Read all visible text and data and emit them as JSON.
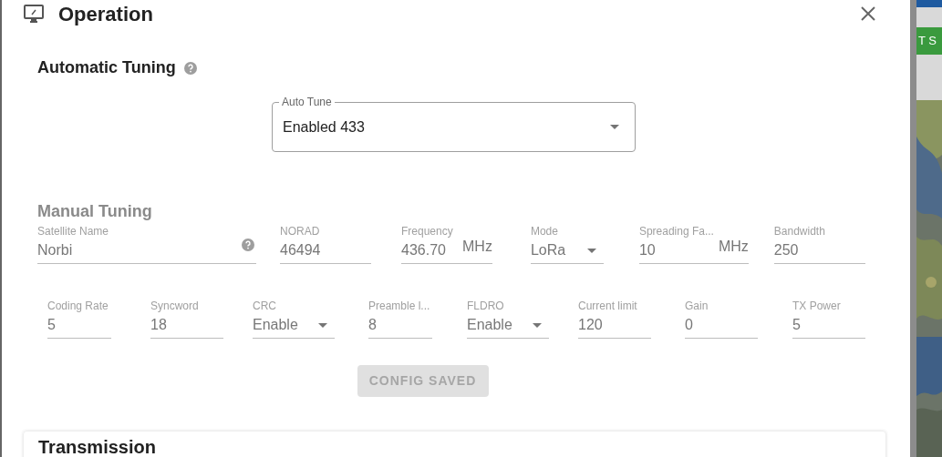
{
  "dialog": {
    "title": "Operation"
  },
  "automatic_tuning": {
    "heading": "Automatic Tuning",
    "auto_tune": {
      "label": "Auto Tune",
      "value": "Enabled 433"
    }
  },
  "manual_tuning": {
    "heading": "Manual Tuning",
    "disabled": true,
    "rows": [
      {
        "fields": [
          {
            "kind": "text",
            "label": "Satellite Name",
            "value": "Norbi",
            "help": true
          },
          {
            "kind": "text",
            "label": "NORAD",
            "value": "46494"
          },
          {
            "kind": "text",
            "label": "Frequency",
            "value": "436.70",
            "suffix": "MHz"
          },
          {
            "kind": "select",
            "label": "Mode",
            "value": "LoRa"
          },
          {
            "kind": "text",
            "label": "Spreading Fa...",
            "value": "10",
            "suffix": "MHz"
          },
          {
            "kind": "text",
            "label": "Bandwidth",
            "value": "250"
          }
        ]
      },
      {
        "fields": [
          {
            "kind": "text",
            "label": "Coding Rate",
            "value": "5"
          },
          {
            "kind": "text",
            "label": "Syncword",
            "value": "18"
          },
          {
            "kind": "select",
            "label": "CRC",
            "value": "Enable"
          },
          {
            "kind": "text",
            "label": "Preamble l...",
            "value": "8"
          },
          {
            "kind": "select",
            "label": "FLDRO",
            "value": "Enable"
          },
          {
            "kind": "text",
            "label": "Current limit",
            "value": "120"
          },
          {
            "kind": "text",
            "label": "Gain",
            "value": "0"
          },
          {
            "kind": "text",
            "label": "TX Power",
            "value": "5"
          }
        ]
      }
    ]
  },
  "save_button": {
    "label": "CONFIG SAVED",
    "disabled": true
  },
  "transmission": {
    "heading": "Transmission"
  },
  "background_app": {
    "button": "T S"
  }
}
